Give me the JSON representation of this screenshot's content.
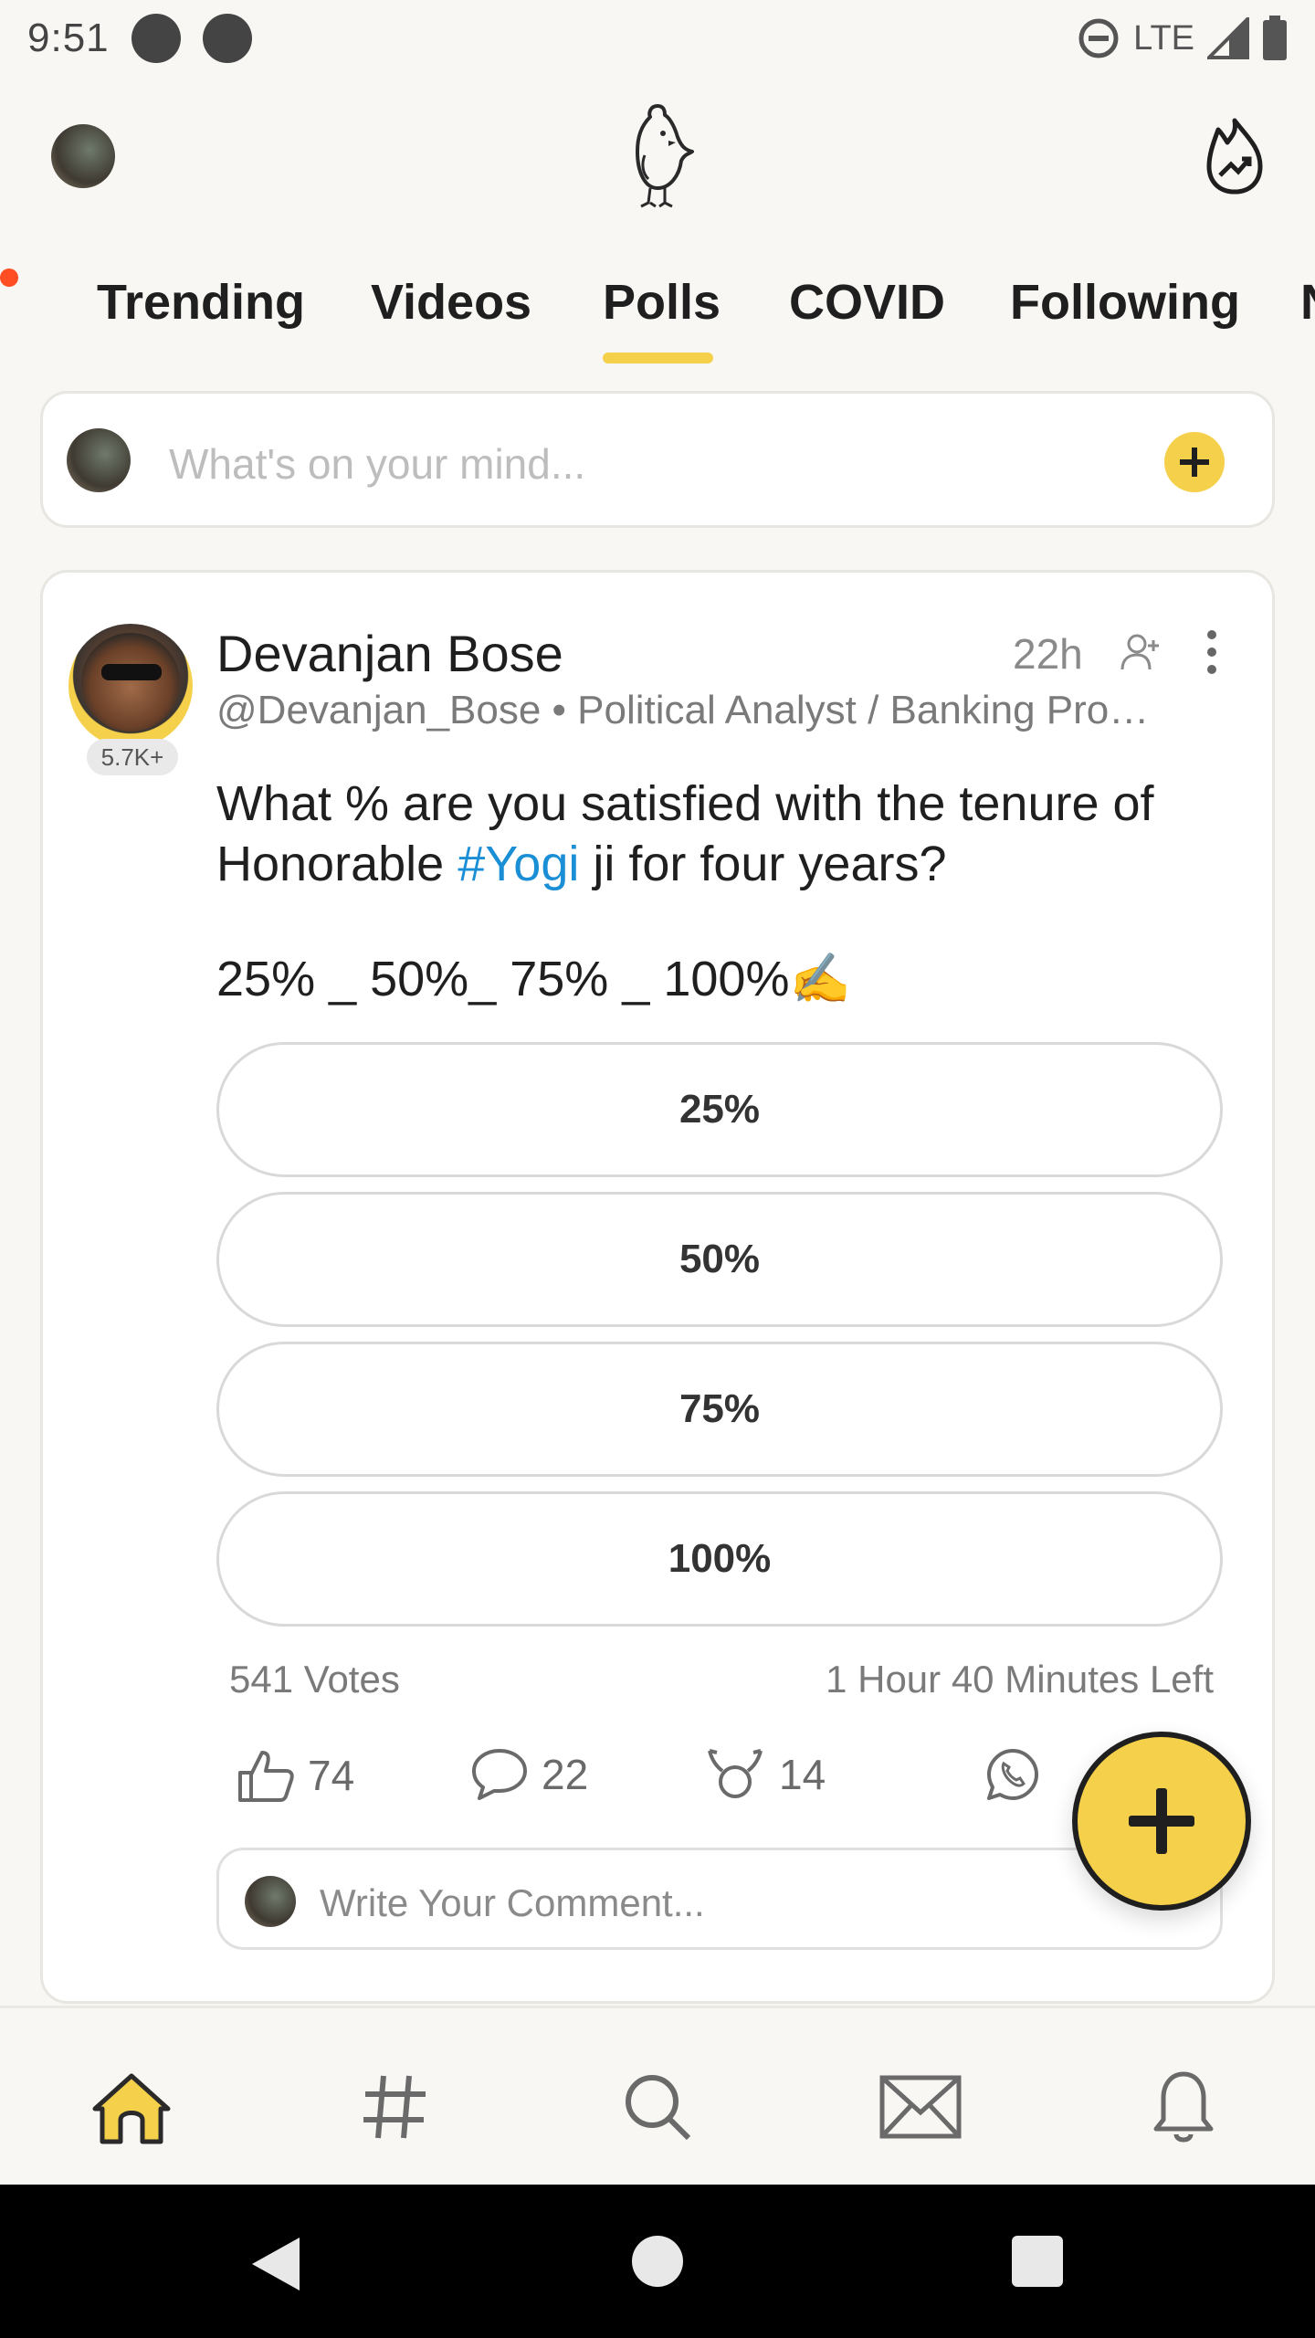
{
  "status_bar": {
    "time": "9:51",
    "network": "LTE"
  },
  "tabs": [
    "Trending",
    "Videos",
    "Polls",
    "COVID",
    "Following",
    "N"
  ],
  "active_tab": "Polls",
  "composer": {
    "placeholder": "What's on your mind..."
  },
  "post": {
    "author": "Devanjan Bose",
    "meta": "@Devanjan_Bose • Political Analyst / Banking Pro…",
    "time": "22h",
    "followers": "5.7K+",
    "text_before": "What % are you satisfied with the tenure of Honorable ",
    "hashtag": "#Yogi",
    "text_after": " ji for four years?",
    "text_line2": "25% _ 50%_ 75% _ 100%✍️",
    "options": [
      "25%",
      "50%",
      "75%",
      "100%"
    ],
    "votes": "541 Votes",
    "time_left": "1 Hour 40 Minutes Left",
    "likes": "74",
    "comments": "22",
    "reposts": "14",
    "comment_placeholder": "Write Your Comment..."
  },
  "colors": {
    "accent": "#f5d04b",
    "hashtag": "#1b8fd6",
    "background": "#f8f7f3"
  }
}
